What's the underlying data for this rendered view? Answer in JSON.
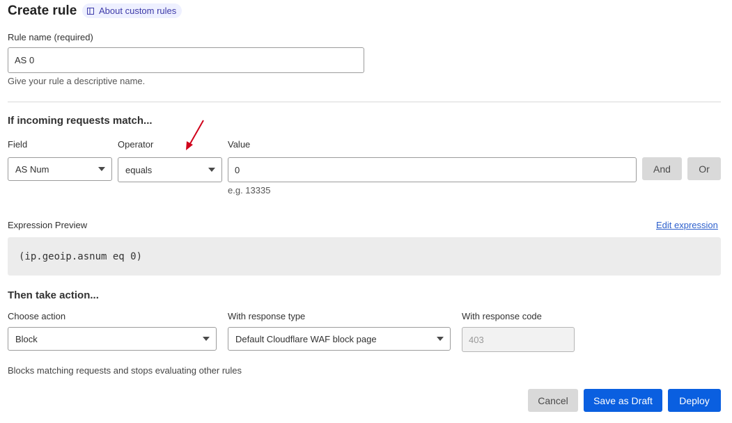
{
  "header": {
    "title": "Create rule",
    "about_link": "About custom rules"
  },
  "rule_name": {
    "label": "Rule name (required)",
    "value": "AS 0",
    "help": "Give your rule a descriptive name."
  },
  "match": {
    "heading": "If incoming requests match...",
    "field_label": "Field",
    "field_value": "AS Num",
    "operator_label": "Operator",
    "operator_value": "equals",
    "value_label": "Value",
    "value_value": "0",
    "value_hint": "e.g. 13335",
    "and_label": "And",
    "or_label": "Or"
  },
  "expression": {
    "label": "Expression Preview",
    "edit_link": "Edit expression",
    "code": "(ip.geoip.asnum eq 0)"
  },
  "action": {
    "heading": "Then take action...",
    "choose_label": "Choose action",
    "choose_value": "Block",
    "response_type_label": "With response type",
    "response_type_value": "Default Cloudflare WAF block page",
    "response_code_label": "With response code",
    "response_code_value": "403",
    "description": "Blocks matching requests and stops evaluating other rules"
  },
  "footer": {
    "cancel_label": "Cancel",
    "draft_label": "Save as Draft",
    "deploy_label": "Deploy"
  },
  "colors": {
    "primary": "#0a5fe0",
    "annotation_arrow": "#d0021b",
    "pill_bg": "#eef0ff"
  },
  "icons": {
    "about": "book-icon",
    "dropdown": "chevron-down-icon",
    "annotation": "red-arrow-icon"
  }
}
